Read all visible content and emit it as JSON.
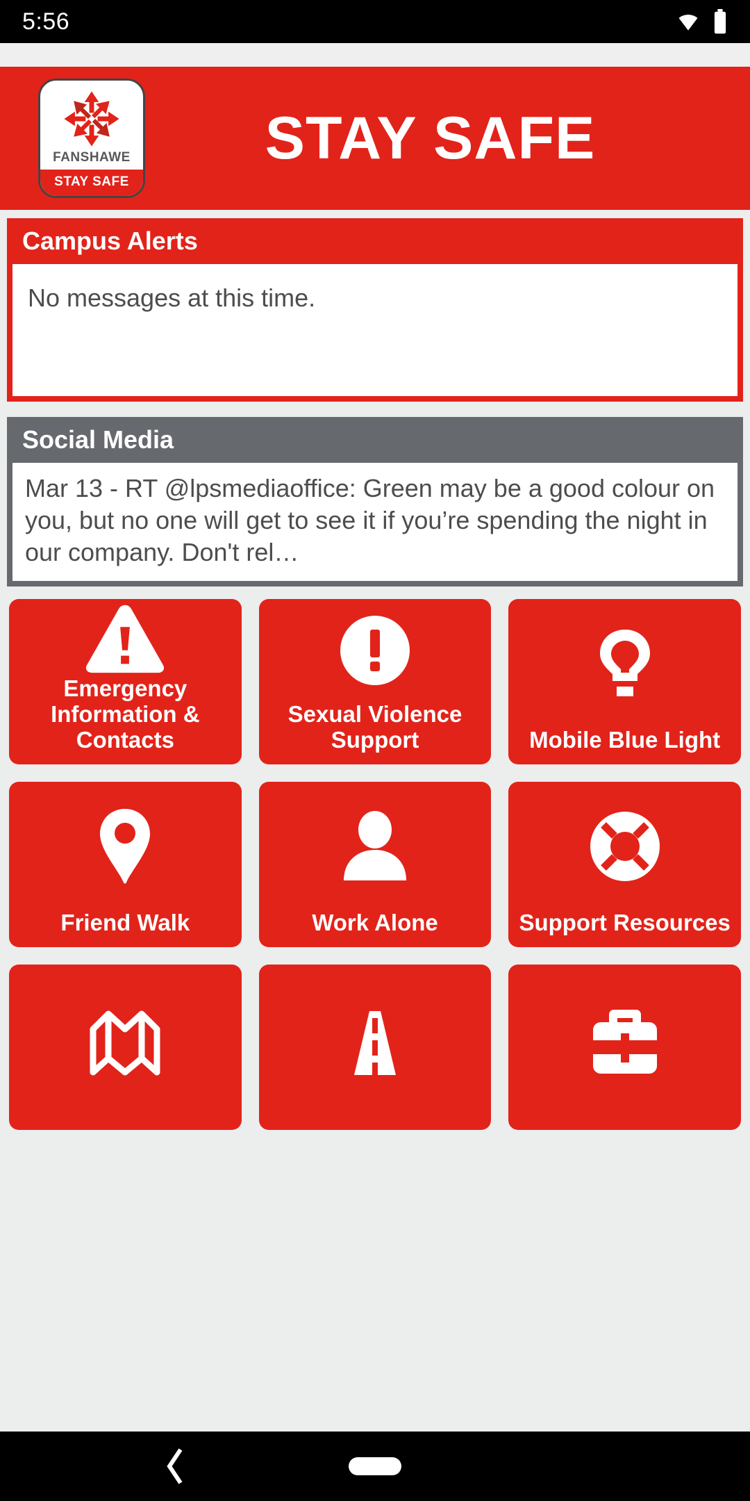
{
  "status_bar": {
    "time": "5:56",
    "icons": [
      "wifi-icon",
      "battery-icon"
    ]
  },
  "header": {
    "title": "STAY SAFE",
    "logo": {
      "mark": "fanshawe-star-icon",
      "wordmark": "FANSHAWE",
      "strip": "STAY SAFE"
    },
    "brand_color": "#e2231a"
  },
  "alerts": {
    "heading": "Campus Alerts",
    "message": "No messages at this time.",
    "header_color": "#e2231a"
  },
  "social": {
    "heading": "Social Media",
    "post": "Mar 13 - RT @lpsmediaoffice: Green may be a good colour on you, but no one will get to see it if you’re spending the night in our company. Don't rel…",
    "header_color": "#666a6e"
  },
  "tiles": [
    {
      "label": "Emergency Information & Contacts",
      "icon": "warning-triangle-icon"
    },
    {
      "label": "Sexual Violence Support",
      "icon": "exclamation-circle-icon"
    },
    {
      "label": "Mobile Blue Light",
      "icon": "light-bulb-icon"
    },
    {
      "label": "Friend Walk",
      "icon": "map-pin-icon"
    },
    {
      "label": "Work Alone",
      "icon": "person-icon"
    },
    {
      "label": "Support Resources",
      "icon": "life-ring-icon"
    },
    {
      "label": "",
      "icon": "folded-map-icon"
    },
    {
      "label": "",
      "icon": "road-icon"
    },
    {
      "label": "",
      "icon": "first-aid-kit-icon"
    }
  ],
  "nav_bar": {
    "back": "back-icon",
    "home": "home-pill-icon"
  }
}
